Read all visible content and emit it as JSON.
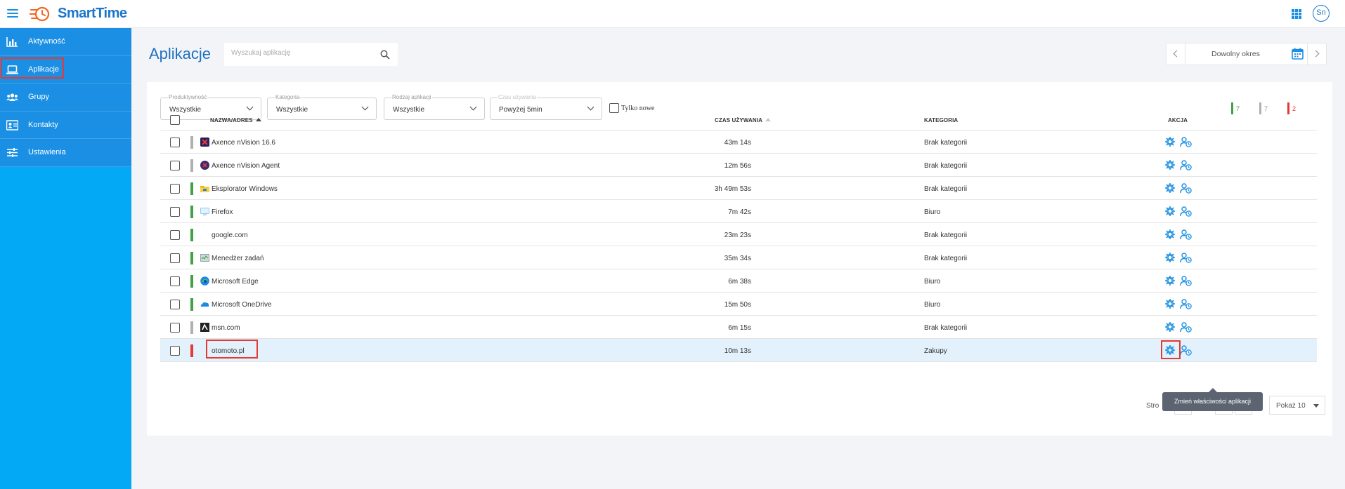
{
  "brand": {
    "name": "SmartTime",
    "user_initials": "Sn"
  },
  "sidebar": {
    "items": [
      {
        "label": "Aktywność",
        "icon": "bar-chart-icon"
      },
      {
        "label": "Aplikacje",
        "icon": "laptop-icon",
        "active": true
      },
      {
        "label": "Grupy",
        "icon": "users-icon"
      },
      {
        "label": "Kontakty",
        "icon": "contact-card-icon"
      },
      {
        "label": "Ustawienia",
        "icon": "sliders-icon"
      }
    ]
  },
  "header": {
    "title": "Aplikacje",
    "search_placeholder": "Wyszukaj aplikację",
    "period_label": "Dowolny okres"
  },
  "filters": {
    "productivity": {
      "label": "Produktywność",
      "value": "Wszystkie"
    },
    "category": {
      "label": "Kategoria",
      "value": "Wszystkie"
    },
    "app_type": {
      "label": "Rodzaj aplikacji",
      "value": "Wszystkie"
    },
    "usage_time": {
      "label": "Czas używania",
      "value": "Powyżej 5min"
    },
    "only_new_label": "Tylko nowe"
  },
  "counters": {
    "productive": "7",
    "neutral": "7",
    "unproductive": "2",
    "colors": {
      "productive": "#43a047",
      "neutral": "#b0b0b0",
      "unproductive": "#e53935"
    }
  },
  "table": {
    "columns": {
      "name": "NAZWA/ADRES",
      "time": "CZAS UŻYWANIA",
      "category": "KATEGORIA",
      "action": "AKCJA"
    },
    "rows": [
      {
        "name": "Axence nVision 16.6",
        "time": "43m 14s",
        "category": "Brak kategorii",
        "status": "neutral",
        "icon": "axence-nvision-icon"
      },
      {
        "name": "Axence nVision Agent",
        "time": "12m 56s",
        "category": "Brak kategorii",
        "status": "neutral",
        "icon": "axence-agent-icon"
      },
      {
        "name": "Eksplorator Windows",
        "time": "3h 49m 53s",
        "category": "Brak kategorii",
        "status": "productive",
        "icon": "folder-icon"
      },
      {
        "name": "Firefox",
        "time": "7m 42s",
        "category": "Biuro",
        "status": "productive",
        "icon": "monitor-icon"
      },
      {
        "name": "google.com",
        "time": "23m 23s",
        "category": "Brak kategorii",
        "status": "productive",
        "icon": ""
      },
      {
        "name": "Menedżer zadań",
        "time": "35m 34s",
        "category": "Brak kategorii",
        "status": "productive",
        "icon": "task-manager-icon"
      },
      {
        "name": "Microsoft Edge",
        "time": "6m 38s",
        "category": "Biuro",
        "status": "productive",
        "icon": "edge-icon"
      },
      {
        "name": "Microsoft OneDrive",
        "time": "15m 50s",
        "category": "Biuro",
        "status": "productive",
        "icon": "onedrive-icon"
      },
      {
        "name": "msn.com",
        "time": "6m 15s",
        "category": "Brak kategorii",
        "status": "neutral",
        "icon": "msn-icon"
      },
      {
        "name": "otomoto.pl",
        "time": "10m 13s",
        "category": "Zakupy",
        "status": "unproductive",
        "icon": "",
        "selected": true
      }
    ]
  },
  "pager": {
    "label": "Stro",
    "show_label": "Pokaż 10"
  },
  "tooltip": "Zmień właściwości aplikacji",
  "colors": {
    "primary": "#1a8fe3",
    "sidebar_bg": "#03a9f4",
    "title": "#1e70c1",
    "highlight": "#e53935"
  }
}
